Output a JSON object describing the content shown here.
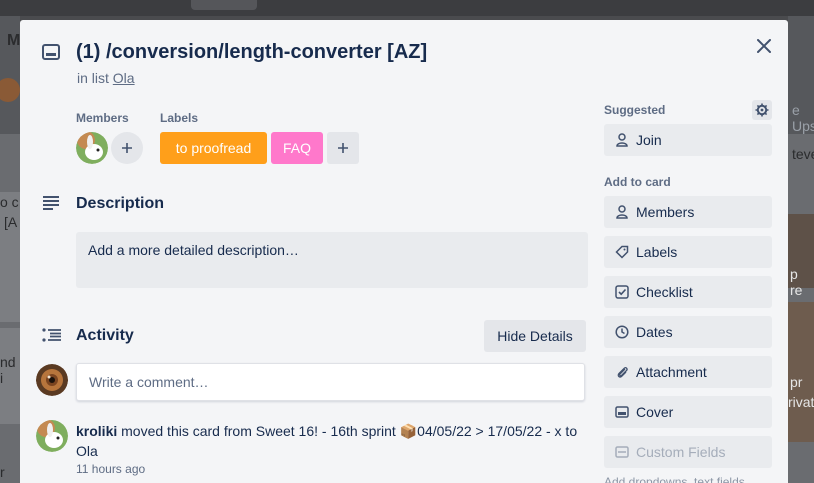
{
  "background": {
    "left_letter": "M",
    "left_snippets": [
      "o c",
      "[A",
      "nd i",
      "r Ca"
    ],
    "right_snippets": [
      "e Ups",
      "teve",
      "p re",
      "pr",
      "rivat"
    ]
  },
  "card": {
    "title": "(1) /conversion/length-converter [AZ]",
    "in_list_prefix": "in list",
    "list_name": "Ola"
  },
  "members": {
    "heading": "Members"
  },
  "labels": {
    "heading": "Labels",
    "items": [
      {
        "text": "to proofread",
        "color": "#ff9f1a"
      },
      {
        "text": "FAQ",
        "color": "#ff78cb"
      }
    ]
  },
  "description": {
    "title": "Description",
    "placeholder": "Add a more detailed description…"
  },
  "activity": {
    "title": "Activity",
    "toggle_label": "Hide Details",
    "comment_placeholder": "Write a comment…",
    "entries": [
      {
        "user": "kroliki",
        "text_before": " moved this card from Sweet 16! - 16th sprint ",
        "emoji": "📦",
        "text_after": "04/05/22 > 17/05/22 - x to Ola",
        "time": "11 hours ago"
      }
    ]
  },
  "sidebar": {
    "suggested_heading": "Suggested",
    "join_label": "Join",
    "add_to_card_heading": "Add to card",
    "buttons": [
      {
        "label": "Members",
        "icon": "person-icon"
      },
      {
        "label": "Labels",
        "icon": "tag-icon"
      },
      {
        "label": "Checklist",
        "icon": "checkbox-icon"
      },
      {
        "label": "Dates",
        "icon": "clock-icon"
      },
      {
        "label": "Attachment",
        "icon": "paperclip-icon"
      },
      {
        "label": "Cover",
        "icon": "card-cover-icon"
      },
      {
        "label": "Custom Fields",
        "icon": "custom-fields-icon"
      }
    ],
    "custom_fields_note": "Add dropdowns, text fields,"
  },
  "colors": {
    "modal_bg": "#f4f5f7",
    "text": "#172b4d",
    "muted": "#5e6c84"
  }
}
